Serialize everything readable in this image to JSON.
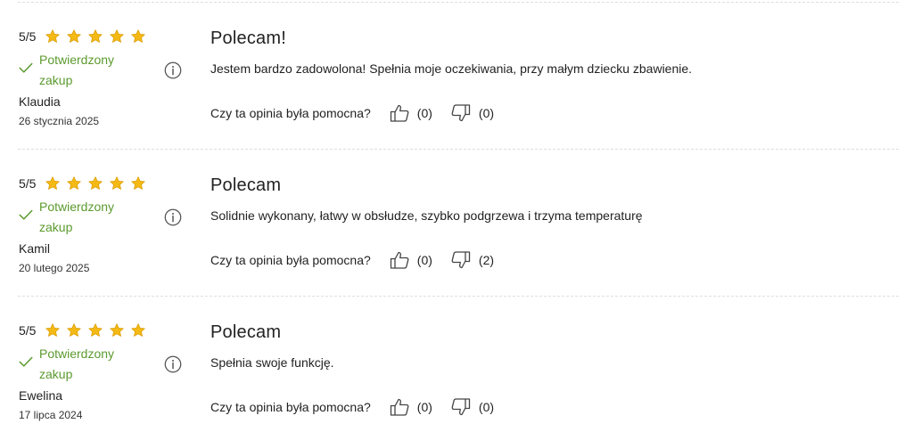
{
  "helpful_question": "Czy ta opinia była pomocna?",
  "verified_label": "Potwierdzony zakup",
  "star_color": "#f5b915",
  "verified_color": "#5b9a2e",
  "reviews": [
    {
      "score": "5/5",
      "rating": 5,
      "author": "Klaudia",
      "date": "26 stycznia 2025",
      "title": "Polecam!",
      "body": "Jestem bardzo zadowolona! Spełnia moje oczekiwania, przy małym dziecku zbawienie.",
      "up": "(0)",
      "down": "(0)"
    },
    {
      "score": "5/5",
      "rating": 5,
      "author": "Kamil",
      "date": "20 lutego 2025",
      "title": "Polecam",
      "body": "Solidnie wykonany, łatwy w obsłudze, szybko podgrzewa i trzyma temperaturę",
      "up": "(0)",
      "down": "(2)"
    },
    {
      "score": "5/5",
      "rating": 5,
      "author": "Ewelina",
      "date": "17 lipca 2024",
      "title": "Polecam",
      "body": "Spełnia swoje funkcję.",
      "up": "(0)",
      "down": "(0)"
    }
  ]
}
